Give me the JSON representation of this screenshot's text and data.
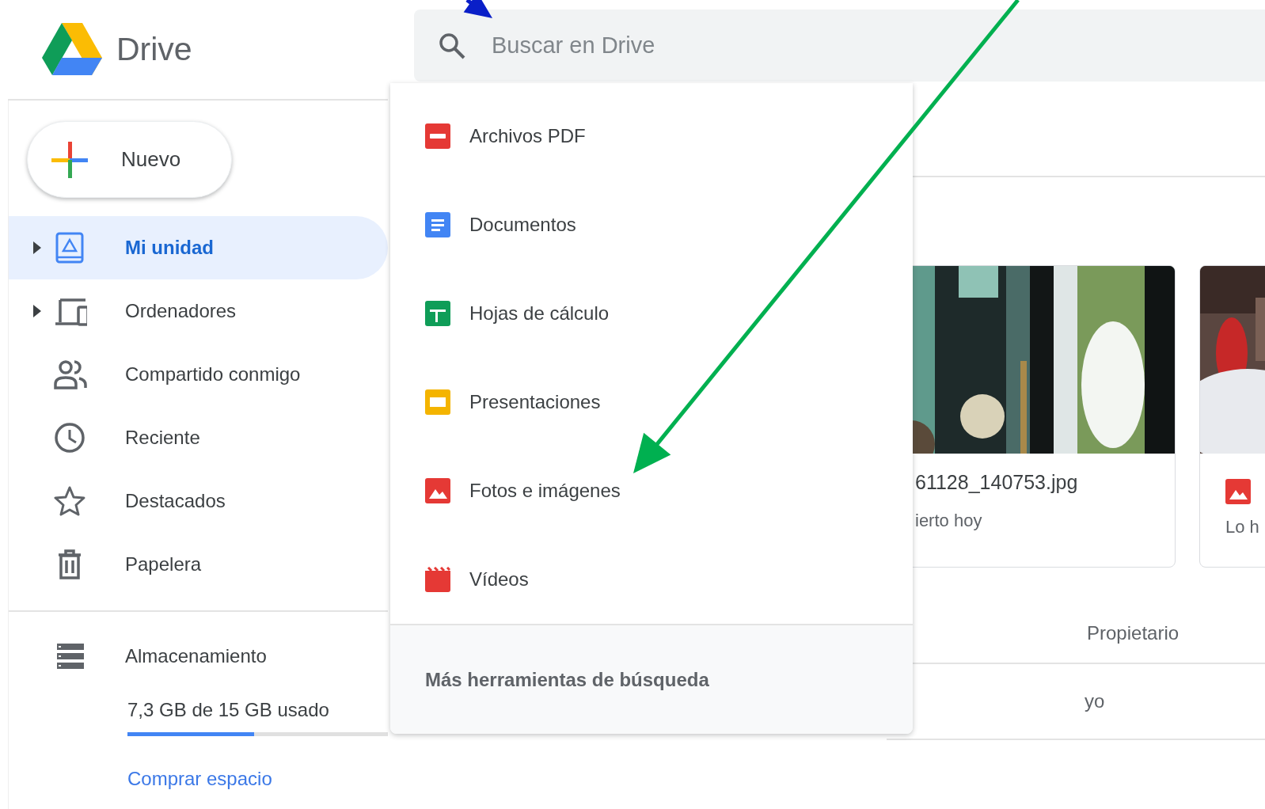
{
  "app": {
    "name": "Drive"
  },
  "search": {
    "placeholder": "Buscar en Drive"
  },
  "new_button": {
    "label": "Nuevo"
  },
  "sidebar": {
    "items": [
      {
        "label": "Mi unidad",
        "selected": true,
        "expandable": true
      },
      {
        "label": "Ordenadores",
        "selected": false,
        "expandable": true
      },
      {
        "label": "Compartido conmigo",
        "selected": false,
        "expandable": false
      },
      {
        "label": "Reciente",
        "selected": false,
        "expandable": false
      },
      {
        "label": "Destacados",
        "selected": false,
        "expandable": false
      },
      {
        "label": "Papelera",
        "selected": false,
        "expandable": false
      }
    ]
  },
  "storage": {
    "label": "Almacenamiento",
    "usage": "7,3 GB de 15 GB usado",
    "level": 0.487,
    "link": "Comprar espacio"
  },
  "search_menu": {
    "items": [
      {
        "label": "Archivos PDF"
      },
      {
        "label": "Documentos"
      },
      {
        "label": "Hojas de cálculo"
      },
      {
        "label": "Presentaciones"
      },
      {
        "label": "Fotos e imágenes"
      },
      {
        "label": "Vídeos"
      }
    ],
    "footer": "Más herramientas de búsqueda"
  },
  "files": [
    {
      "kind": "picture",
      "name": "61128_140753.jpg",
      "meta": "ierto hoy"
    },
    {
      "kind": "picture",
      "meta": "Lo h"
    }
  ],
  "table": {
    "columns": [
      "Propietario"
    ],
    "rows": [
      [
        "yo"
      ]
    ]
  },
  "annotations": [
    {
      "color": "#0a1fc8"
    },
    {
      "color": "#00b050"
    }
  ]
}
